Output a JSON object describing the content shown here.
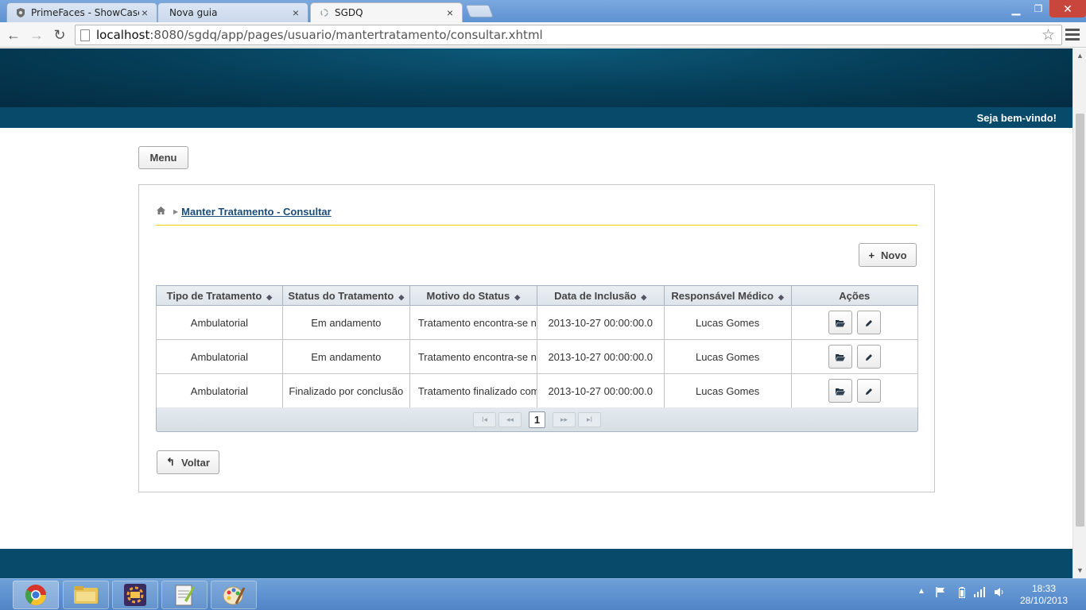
{
  "browser": {
    "tabs": [
      {
        "title": "PrimeFaces - ShowCase",
        "icon": "primefaces-favicon",
        "active": false
      },
      {
        "title": "Nova guia",
        "icon": "blank-favicon",
        "active": false
      },
      {
        "title": "SGDQ",
        "icon": "loading-favicon",
        "active": true
      }
    ],
    "url_host": "localhost",
    "url_rest": ":8080/sgdq/app/pages/usuario/mantertratamento/consultar.xhtml",
    "window_controls": {
      "minimize": "▁",
      "restore": "❐",
      "close": "✕"
    },
    "nav": {
      "back": "←",
      "forward": "→",
      "reload": "↻",
      "star": "☆"
    }
  },
  "header": {
    "welcome": "Seja bem-vindo!"
  },
  "menu_button": "Menu",
  "breadcrumb": {
    "home_icon": "home-icon",
    "current": "Manter Tratamento - Consultar"
  },
  "novo_button": "Novo",
  "table": {
    "columns": [
      "Tipo de Tratamento",
      "Status do Tratamento",
      "Motivo do Status",
      "Data de Inclusão",
      "Responsável Médico",
      "Ações"
    ],
    "rows": [
      {
        "tipo": "Ambulatorial",
        "status": "Em andamento",
        "motivo": "Tratamento encontra-se n",
        "data": "2013-10-27 00:00:00.0",
        "medico": "Lucas Gomes"
      },
      {
        "tipo": "Ambulatorial",
        "status": "Em andamento",
        "motivo": "Tratamento encontra-se n",
        "data": "2013-10-27 00:00:00.0",
        "medico": "Lucas Gomes"
      },
      {
        "tipo": "Ambulatorial",
        "status": "Finalizado por conclusão",
        "motivo": "Tratamento finalizado com",
        "data": "2013-10-27 00:00:00.0",
        "medico": "Lucas Gomes"
      }
    ],
    "actions": {
      "open_icon": "folder-open-icon",
      "edit_icon": "pencil-icon"
    }
  },
  "paginator": {
    "first": "I◂",
    "prev": "◂◂",
    "current_page": "1",
    "next": "▸▸",
    "last": "▸I"
  },
  "voltar_button": "Voltar",
  "taskbar": {
    "apps": [
      "chrome-icon",
      "file-explorer-icon",
      "java-ee-ide-icon",
      "notepad-plus-icon",
      "paint-icon"
    ],
    "time": "18:33",
    "date": "28/10/2013"
  }
}
